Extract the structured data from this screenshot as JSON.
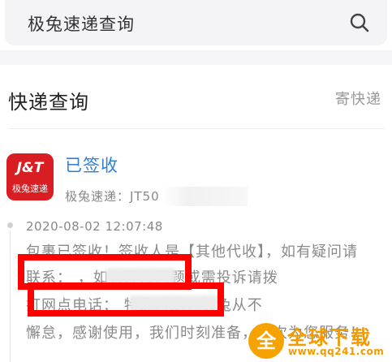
{
  "search": {
    "query": "极兔速递查询",
    "icon": "search-icon"
  },
  "section": {
    "title": "快递查询",
    "send_link": "寄快递"
  },
  "package": {
    "logo_top": "J&T",
    "logo_bottom": "极兔速递",
    "status": "已签收",
    "carrier_line": "极兔速递：JT50",
    "brand_color": "#d81e23",
    "status_color": "#2f7fd6"
  },
  "timeline": {
    "timestamp": "2020-08-02 12:07:48",
    "lines": [
      "包裹已签收！签收人是【其他代收】，如有疑问请",
      "联系：                                    ，如有异常问题或需投诉请拨",
      "打网点电话：                                    特殊时期，极兔从不",
      "懈怠，感谢使用，我们时刻准备，再次为您服务！"
    ]
  },
  "watermark": {
    "emblem": "全",
    "title": "全球下载",
    "url": "www.qq241.com"
  }
}
